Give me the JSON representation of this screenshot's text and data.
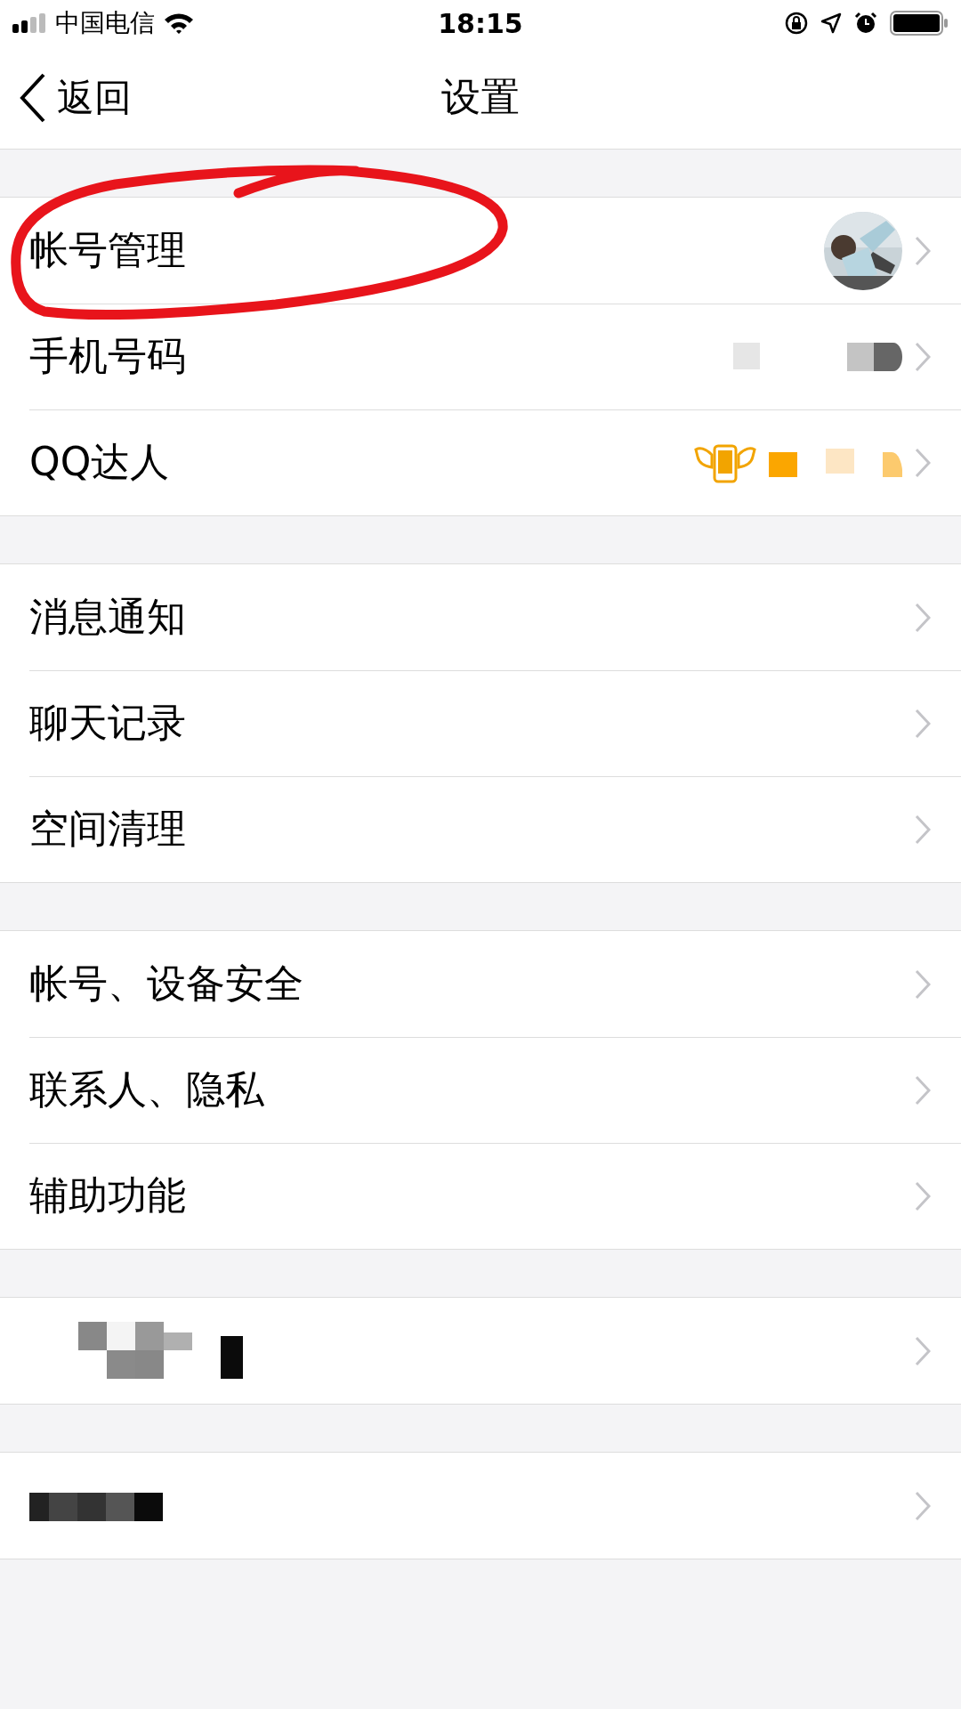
{
  "status_bar": {
    "carrier": "中国电信",
    "time": "18:15"
  },
  "nav": {
    "back_label": "返回",
    "title": "设置"
  },
  "annotation": {
    "kind": "ellipse"
  },
  "groups": [
    {
      "rows": [
        {
          "label": "帐号管理",
          "kind": "avatar"
        },
        {
          "label": "手机号码",
          "kind": "masked_value"
        },
        {
          "label": "QQ达人",
          "kind": "badge"
        }
      ]
    },
    {
      "rows": [
        {
          "label": "消息通知",
          "kind": "plain"
        },
        {
          "label": "聊天记录",
          "kind": "plain"
        },
        {
          "label": "空间清理",
          "kind": "plain"
        }
      ]
    },
    {
      "rows": [
        {
          "label": "帐号、设备安全",
          "kind": "plain"
        },
        {
          "label": "联系人、隐私",
          "kind": "plain"
        },
        {
          "label": "辅助功能",
          "kind": "plain"
        }
      ]
    },
    {
      "rows": [
        {
          "kind": "masked_label_light"
        }
      ]
    },
    {
      "rows": [
        {
          "kind": "masked_label_dark"
        }
      ]
    }
  ]
}
